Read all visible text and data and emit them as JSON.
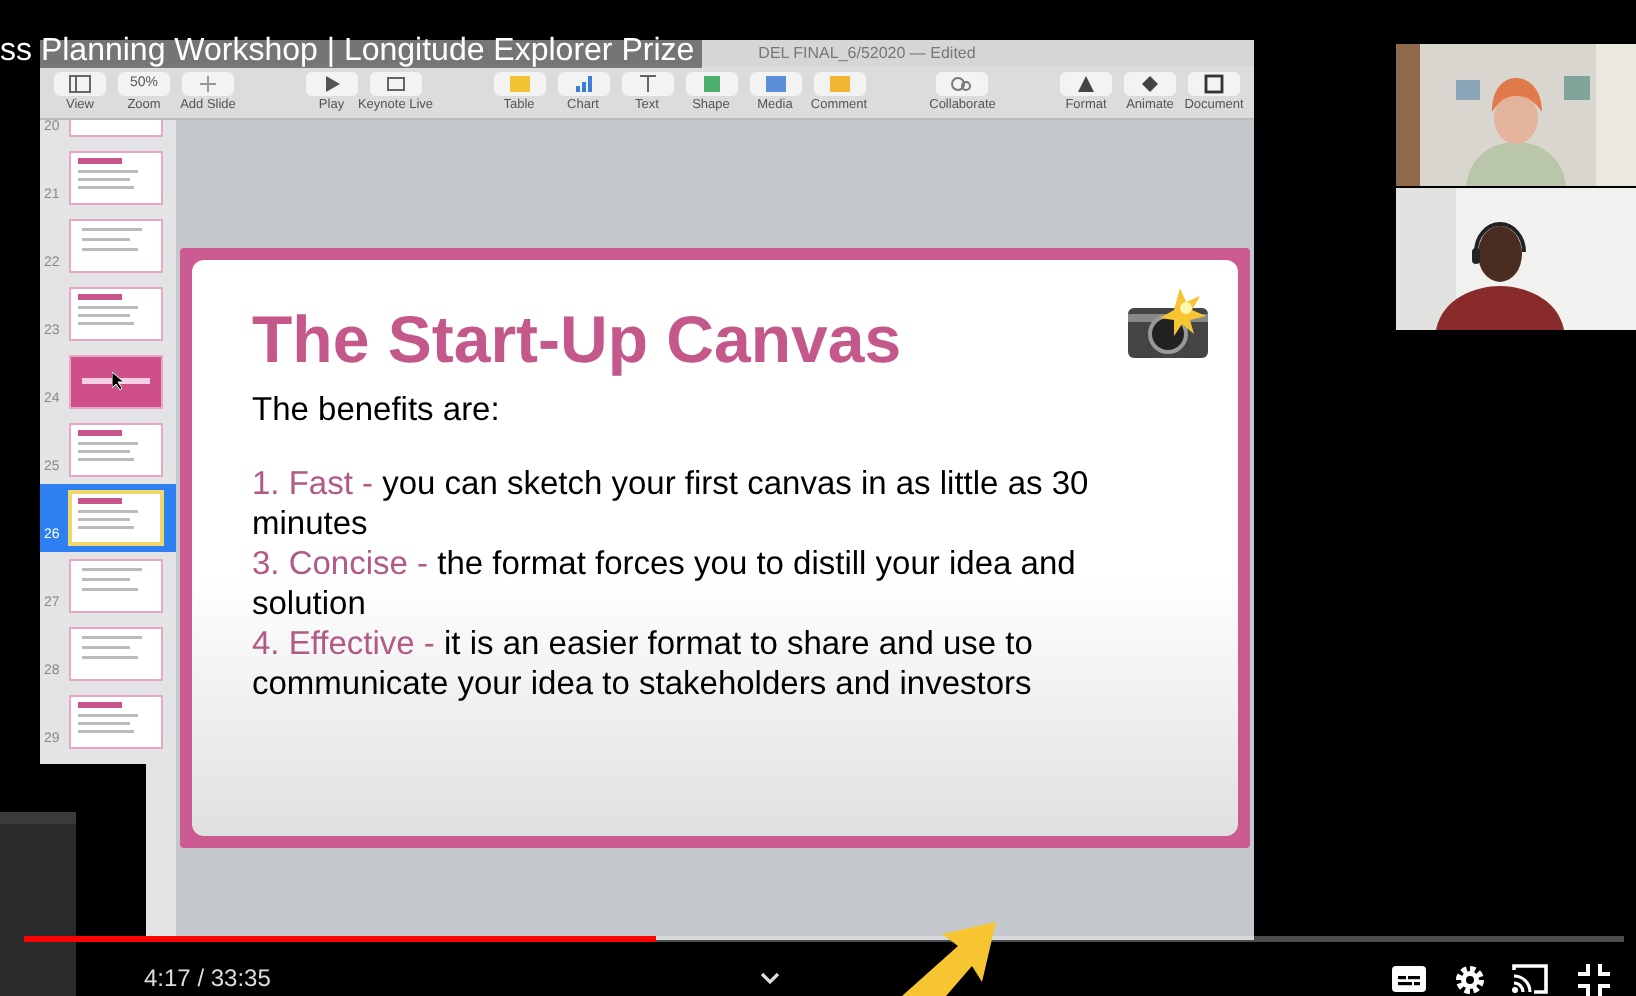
{
  "video": {
    "title": "ss Planning Workshop | Longitude Explorer Prize",
    "time": "4:17 / 33:35",
    "progress": {
      "level": 0.395
    }
  },
  "keynote": {
    "window_title": "DEL FINAL_6/52020 — Edited",
    "toolbar_groups": [
      {
        "items": [
          {
            "label": "View"
          },
          {
            "label": "Zoom",
            "value": "50%"
          },
          {
            "label": "Add Slide"
          }
        ]
      },
      {
        "items": [
          {
            "label": "Play"
          },
          {
            "label": "Keynote Live"
          }
        ]
      },
      {
        "items": [
          {
            "label": "Table"
          },
          {
            "label": "Chart"
          },
          {
            "label": "Text"
          },
          {
            "label": "Shape"
          },
          {
            "label": "Media"
          },
          {
            "label": "Comment"
          }
        ]
      },
      {
        "items": [
          {
            "label": "Collaborate"
          }
        ]
      },
      {
        "items": [
          {
            "label": "Format"
          },
          {
            "label": "Animate"
          },
          {
            "label": "Document"
          }
        ]
      }
    ],
    "slides": [
      {
        "number": "20",
        "kind": "lines",
        "selected": false
      },
      {
        "number": "21",
        "kind": "heading",
        "selected": false
      },
      {
        "number": "22",
        "kind": "lines",
        "selected": false
      },
      {
        "number": "23",
        "kind": "heading",
        "selected": false
      },
      {
        "number": "24",
        "kind": "pink",
        "selected": false
      },
      {
        "number": "25",
        "kind": "heading",
        "selected": false
      },
      {
        "number": "26",
        "kind": "heading",
        "selected": true
      },
      {
        "number": "27",
        "kind": "lines",
        "selected": false
      },
      {
        "number": "28",
        "kind": "lines",
        "selected": false
      },
      {
        "number": "29",
        "kind": "heading",
        "selected": false
      }
    ],
    "slide": {
      "title": "The Start-Up Canvas",
      "intro": "The benefits are:",
      "points": [
        {
          "label": "1. Fast -",
          "text": "you can sketch your first canvas in as little as 30 minutes"
        },
        {
          "label": "3. Concise -",
          "text": " the format forces you to distill your idea and solution"
        },
        {
          "label": "4. Effective -",
          "text": "it is an easier format to share and use to communicate your idea to stakeholders and investors"
        }
      ]
    }
  }
}
